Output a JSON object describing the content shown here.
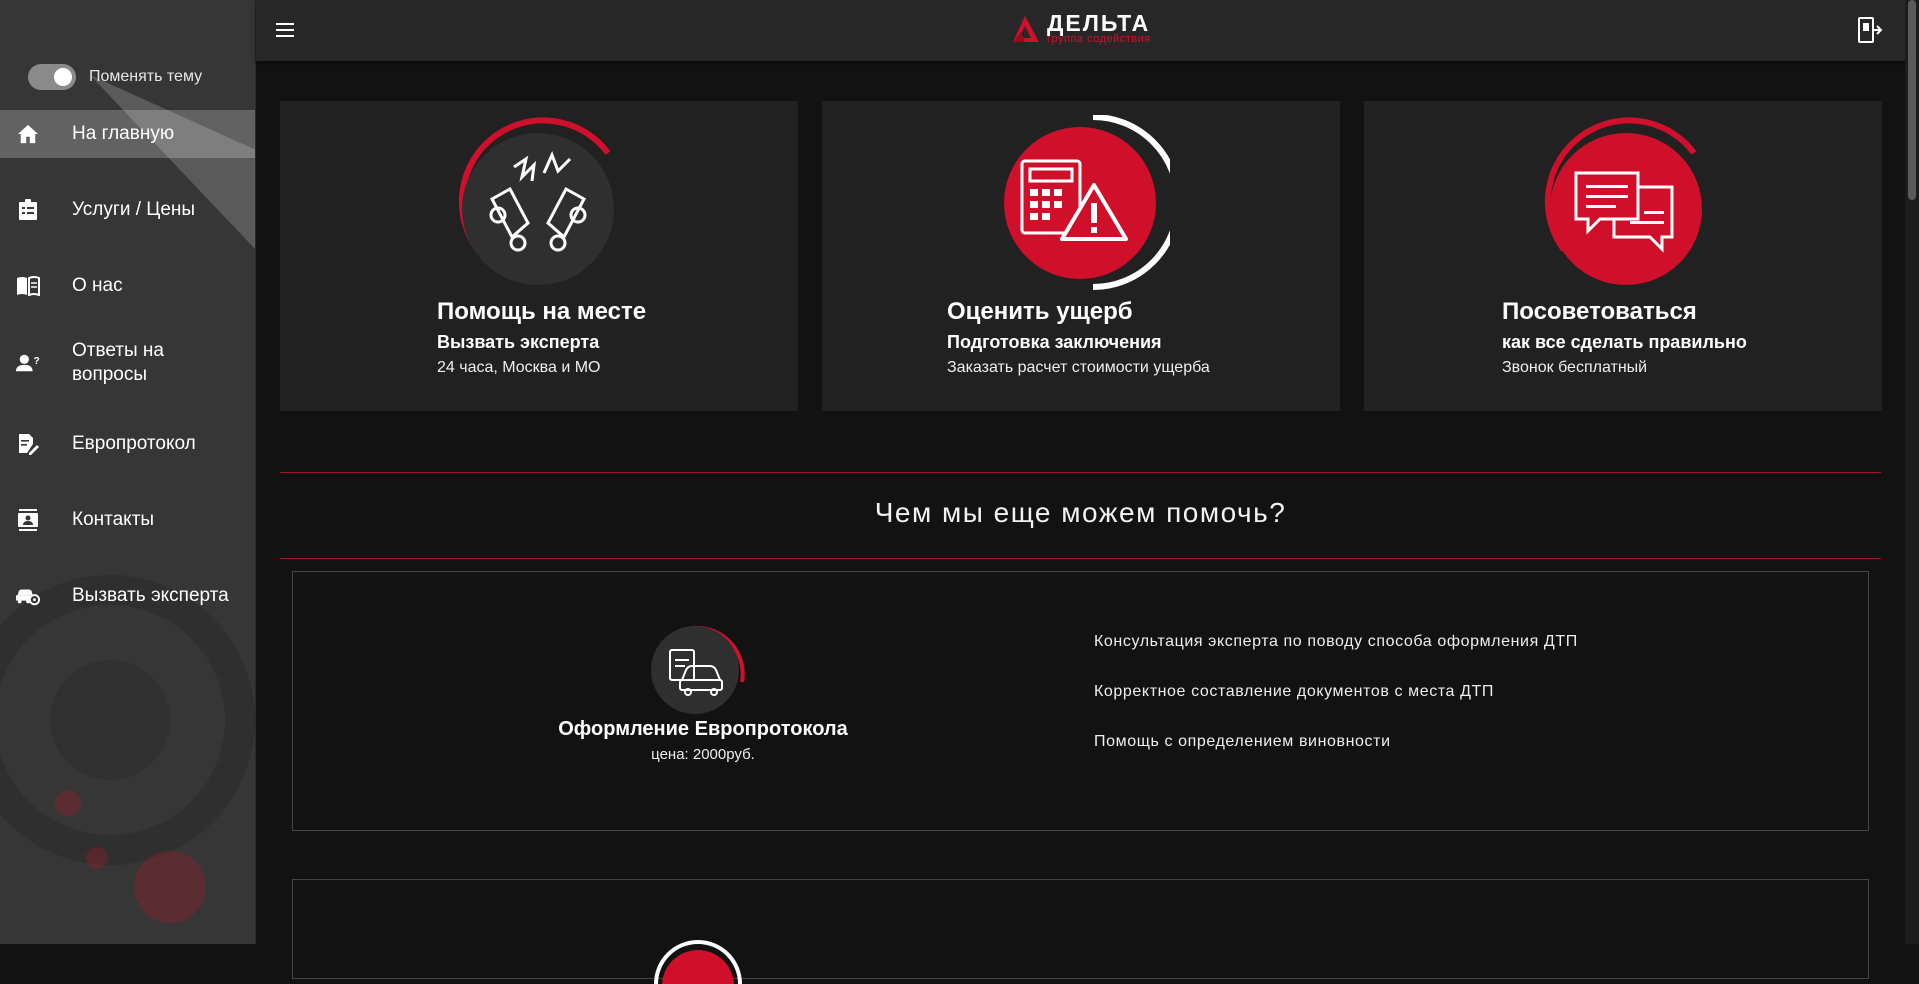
{
  "sidebar": {
    "theme_label": "Поменять тему",
    "items": [
      {
        "label": "На главную",
        "icon": "home-icon"
      },
      {
        "label": "Услуги / Цены",
        "icon": "clipboard-list-icon"
      },
      {
        "label": "О нас",
        "icon": "book-icon"
      },
      {
        "label": "Ответы на вопросы",
        "icon": "person-question-icon"
      },
      {
        "label": "Европротокол",
        "icon": "document-edit-icon"
      },
      {
        "label": "Контакты",
        "icon": "contact-card-icon"
      },
      {
        "label": "Вызвать эксперта",
        "icon": "car-settings-icon"
      }
    ]
  },
  "header": {
    "logo_name": "ДЕЛЬТА",
    "logo_sub": "группа содействия"
  },
  "cards": [
    {
      "title": "Помощь на месте",
      "subtitle": "Вызвать эксперта",
      "desc": "24 часа, Москва и МО",
      "icon": "car-crash-icon"
    },
    {
      "title": "Оценить ущерб",
      "subtitle": "Подготовка заключения",
      "desc": "Заказать расчет стоимости ущерба",
      "icon": "calculator-warning-icon"
    },
    {
      "title": "Посоветоваться",
      "subtitle": "как все сделать правильно",
      "desc": "Звонок бесплатный",
      "icon": "chat-bubbles-icon"
    }
  ],
  "section_title": "Чем мы еще можем помочь?",
  "services": [
    {
      "name": "Оформление Европротокола",
      "price": "цена: 2000руб.",
      "features": [
        "Консультация эксперта по поводу способа оформления ДТП",
        "Корректное составление документов с места ДТП",
        "Помощь с определением виновности"
      ]
    }
  ],
  "colors": {
    "accent": "#d0102a",
    "sidebar": "#363636",
    "card": "#212121",
    "background": "#121212"
  }
}
